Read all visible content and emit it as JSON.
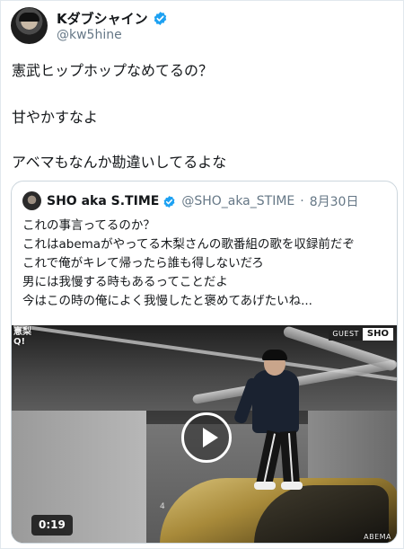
{
  "tweet": {
    "display_name": "Kダブシャイン",
    "handle": "@kw5hine",
    "lines": [
      "憲武ヒップホップなめてるの？",
      "甘やかすなよ",
      "アベマもなんか勘違いしてるよな"
    ]
  },
  "quoted_tweet": {
    "display_name": "SHO aka S.TIME",
    "handle": "@SHO_aka_STIME",
    "separator": "·",
    "date": "8月30日",
    "lines": [
      "これの事言ってるのか？",
      "これはabemaがやってる木梨さんの歌番組の歌を収録前だぞ",
      "これで俺がキレて帰ったら誰も得しないだろ",
      "男には我慢する時もあるってことだよ",
      "今はこの時の俺によく我慢したと褒めてあげたいね..."
    ]
  },
  "video": {
    "corner_logo": "憲梨\nQ!",
    "guest_label": "GUEST",
    "guest_name": "SHO",
    "pillar_number": "4",
    "duration": "0:19",
    "watermark": "ABEMA"
  },
  "icons": {
    "verified": "verified-badge-icon",
    "play": "play-icon"
  },
  "colors": {
    "verified_blue": "#1da1f2",
    "secondary_text": "#657786",
    "border": "#ccd6dd"
  }
}
